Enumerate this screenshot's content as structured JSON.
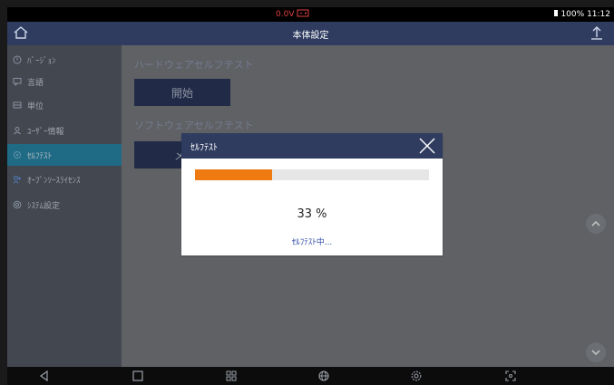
{
  "status_bar": {
    "battery_voltage": "0.0V",
    "battery_status": "100%",
    "time": "11:12"
  },
  "header": {
    "title": "本体設定"
  },
  "sidebar": {
    "items": [
      {
        "label": "ﾊﾞｰｼﾞｮﾝ",
        "icon": "version-icon"
      },
      {
        "label": "言語",
        "icon": "language-icon"
      },
      {
        "label": "単位",
        "icon": "unit-icon"
      },
      {
        "label": "ﾕｰｻﾞｰ情報",
        "icon": "user-icon"
      },
      {
        "label": "ｾﾙﾌﾃｽﾄ",
        "icon": "selftest-icon"
      },
      {
        "label": "ｵｰﾌﾟﾝｿｰｽﾗｲｾﾝｽ",
        "icon": "license-icon"
      },
      {
        "label": "ｼｽﾃﾑ設定",
        "icon": "system-icon"
      }
    ],
    "active_index": 4
  },
  "content": {
    "hardware_title": "ハードウェアセルフテスト",
    "hardware_button": "開始",
    "software_title": "ソフトウェアセルフテスト",
    "software_button": "メ"
  },
  "dialog": {
    "title": "ｾﾙﾌﾃｽﾄ",
    "progress": 0.33,
    "percent_text": "33 %",
    "status_text": "ｾﾙﾌﾃｽﾄ中..."
  },
  "colors": {
    "header_bg": "#2f3c60",
    "accent_active": "#2a8fb3",
    "progress": "#f07a12",
    "battery_warning": "#e04040"
  }
}
